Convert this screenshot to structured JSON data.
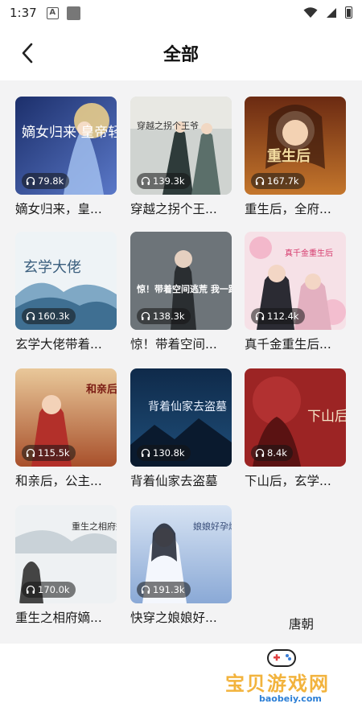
{
  "status": {
    "time": "1:37",
    "a_icon": "A"
  },
  "header": {
    "title": "全部"
  },
  "books": [
    {
      "title": "嫡女归来，皇...",
      "plays": "79.8k"
    },
    {
      "title": "穿越之拐个王...",
      "plays": "139.3k"
    },
    {
      "title": "重生后，全府...",
      "plays": "167.7k"
    },
    {
      "title": "玄学大佬带着...",
      "plays": "160.3k"
    },
    {
      "title": "惊！带着空间...",
      "plays": "138.3k"
    },
    {
      "title": "真千金重生后...",
      "plays": "112.4k"
    },
    {
      "title": "和亲后，公主...",
      "plays": "115.5k"
    },
    {
      "title": "背着仙家去盗墓",
      "plays": "130.8k"
    },
    {
      "title": "下山后，玄学...",
      "plays": "8.4k"
    },
    {
      "title": "重生之相府嫡...",
      "plays": "170.0k"
    },
    {
      "title": "快穿之娘娘好...",
      "plays": "191.3k"
    },
    {
      "title": "唐朝",
      "plays": ""
    }
  ],
  "covers": [
    {
      "text": "嫡女归来 皇帝轻点"
    },
    {
      "text": "穿越之拐个王爷"
    },
    {
      "text": "重生后"
    },
    {
      "text": "玄学大佬"
    },
    {
      "text": "惊！带着空间逃荒 我一路躺赢"
    },
    {
      "text": "真千金重生后"
    },
    {
      "text": "和亲后 公主她被迫出嫁"
    },
    {
      "text": "背着仙家去盗墓"
    },
    {
      "text": "下山后"
    },
    {
      "text": "重生之相府嫡女绝天下"
    },
    {
      "text": "娘娘好孕爆棚 快穿之"
    }
  ],
  "watermark": {
    "title": "宝贝游戏网",
    "url": "baobeiy.com"
  },
  "colors": {
    "accent": "#f2b33d",
    "badge_bg": "rgba(20,20,20,0.55)",
    "page_bg": "#f3f3f4"
  }
}
